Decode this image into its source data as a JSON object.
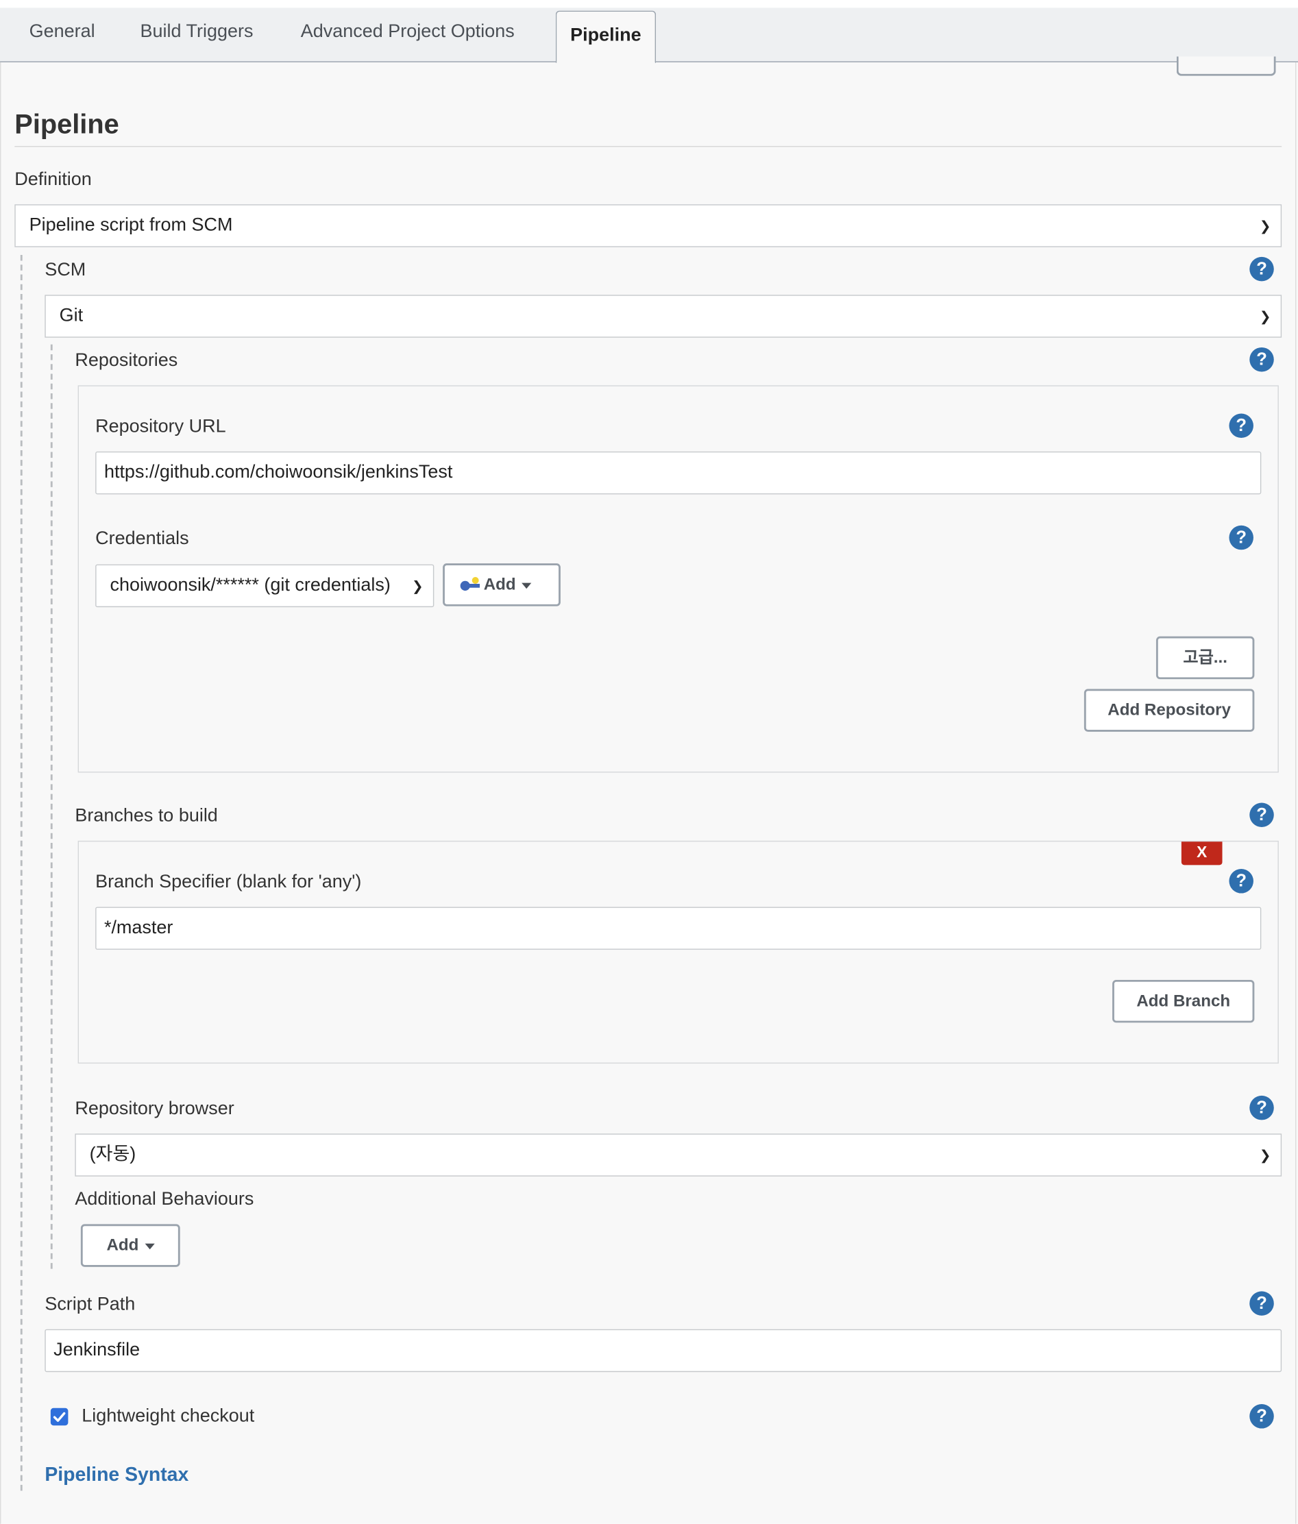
{
  "tabs": [
    {
      "label": "General"
    },
    {
      "label": "Build Triggers"
    },
    {
      "label": "Advanced Project Options"
    },
    {
      "label": "Pipeline",
      "active": true
    }
  ],
  "section": {
    "title": "Pipeline"
  },
  "definition": {
    "label": "Definition",
    "selected": "Pipeline script from SCM"
  },
  "scm": {
    "label": "SCM",
    "selected": "Git"
  },
  "repositories": {
    "label": "Repositories",
    "url_label": "Repository URL",
    "url_value": "https://github.com/choiwoonsik/jenkinsTest",
    "credentials_label": "Credentials",
    "credentials_selected": "choiwoonsik/****** (git credentials)",
    "add_label": "Add",
    "advanced_label": "고급...",
    "add_repository_label": "Add Repository"
  },
  "branches": {
    "label": "Branches to build",
    "delete_label": "X",
    "specifier_label": "Branch Specifier (blank for 'any')",
    "specifier_value": "*/master",
    "add_branch_label": "Add Branch"
  },
  "repo_browser": {
    "label": "Repository browser",
    "selected": "(자동)"
  },
  "additional_behaviours": {
    "label": "Additional Behaviours",
    "add_label": "Add"
  },
  "script_path": {
    "label": "Script Path",
    "value": "Jenkinsfile"
  },
  "lightweight_checkout": {
    "label": "Lightweight checkout",
    "checked": true
  },
  "pipeline_syntax": {
    "label": "Pipeline Syntax"
  },
  "help_icon_glyph": "?",
  "colors": {
    "link": "#2f6fae",
    "help_icon": "#2f6fae",
    "delete": "#c0281b",
    "checkbox": "#2f6fdb"
  }
}
